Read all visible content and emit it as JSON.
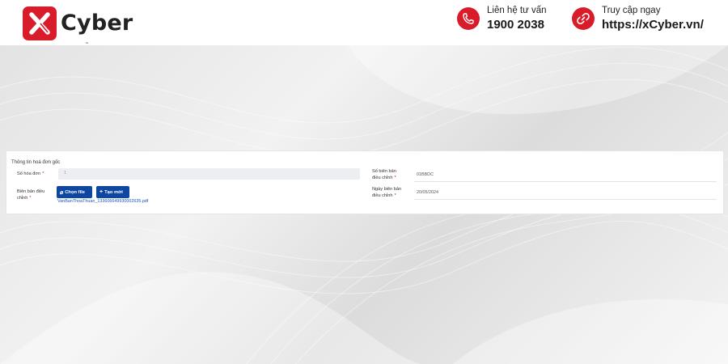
{
  "brand": {
    "name": "Cyber",
    "tm": "™",
    "accent": "#d91c2a"
  },
  "contact": {
    "phone_label": "Liên hệ tư vấn",
    "phone_number": "1900 2038",
    "site_label": "Truy cập ngay",
    "site_url": "https://xCyber.vn/",
    "phone_icon": "phone-icon",
    "site_icon": "link-icon"
  },
  "form": {
    "section_title": "Thông tin hoá đơn gốc",
    "invoice_no": {
      "label": "Số hóa đơn",
      "required": "*",
      "value": "1"
    },
    "adjust_doc": {
      "label_line1": "Biên bản điều",
      "label_line2": "chỉnh",
      "required": "*",
      "choose_file_label": "Chọn file",
      "create_new_label": "Tạo mới",
      "file_name": "VanBanThoaThuan_133606649930002635.pdf"
    },
    "adjust_no": {
      "label_line1": "Số biên bản",
      "label_line2": "điều chỉnh",
      "required": "*",
      "value": "01BBDC"
    },
    "adjust_date": {
      "label_line1": "Ngày biên bản",
      "label_line2": "điều chỉnh",
      "required": "*",
      "value": "20/05/2024"
    }
  },
  "colors": {
    "primary_button": "#0d47a1",
    "link": "#1b56b8"
  }
}
